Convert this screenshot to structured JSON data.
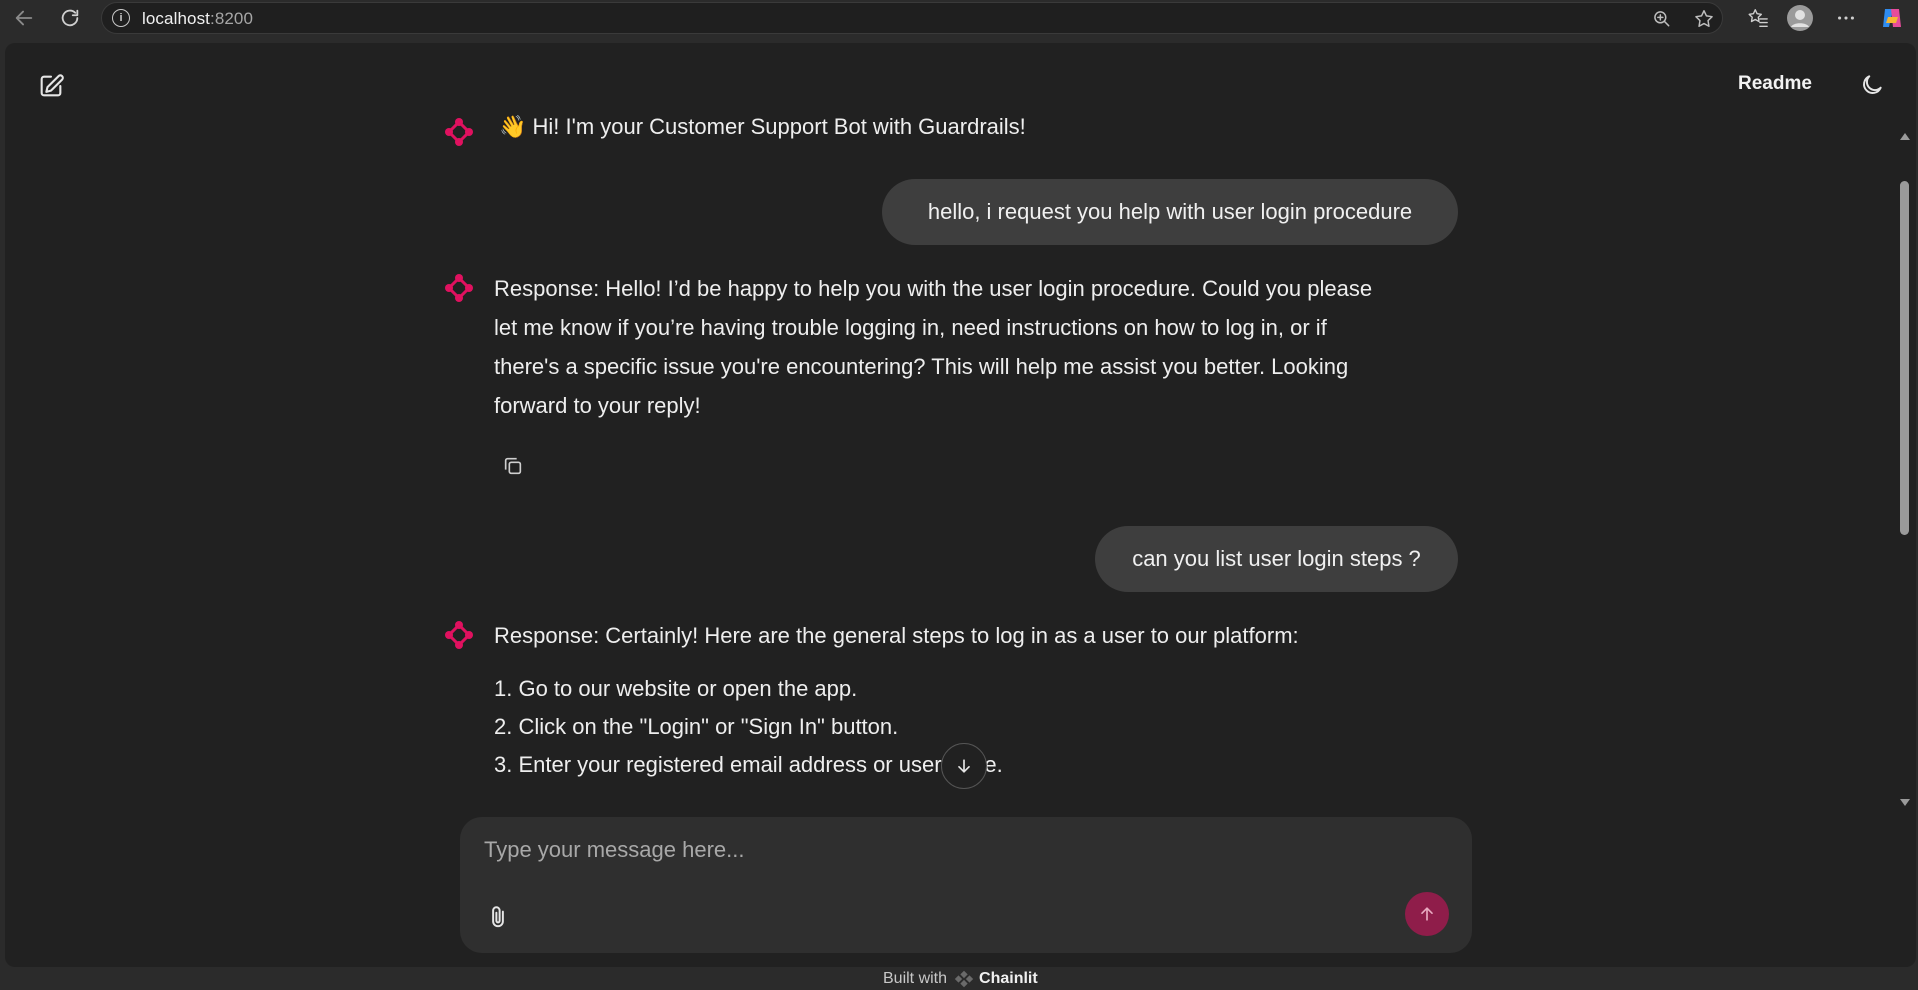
{
  "browser": {
    "url_host": "localhost",
    "url_port": ":8200"
  },
  "header": {
    "readme_label": "Readme"
  },
  "messages": {
    "greeting": "👋 Hi! I'm your Customer Support Bot with Guardrails!",
    "user_1": "hello, i request you help with user login procedure",
    "bot_1": [
      "Response: Hello! I’d be happy to help you with the user login procedure. Could you please",
      "let me know if you’re having trouble logging in, need instructions on how to log in, or if",
      "there's a specific issue you're encountering? This will help me assist you better. Looking",
      "forward to your reply!"
    ],
    "user_2": "can you list user login steps ?",
    "bot_2_intro": "Response: Certainly! Here are the general steps to log in as a user to our platform:",
    "bot_2_steps": [
      "1. Go to our website or open the app.",
      "2. Click on the \"Login\" or \"Sign In\" button.",
      "3. Enter your registered email address or username."
    ]
  },
  "composer": {
    "placeholder": "Type your message here..."
  },
  "footer": {
    "built_with": "Built with",
    "brand": "Chainlit"
  },
  "colors": {
    "accent": "#e0115f",
    "send_button": "#8f1d4a",
    "background": "#212121",
    "bubble": "#3e3e3e"
  }
}
